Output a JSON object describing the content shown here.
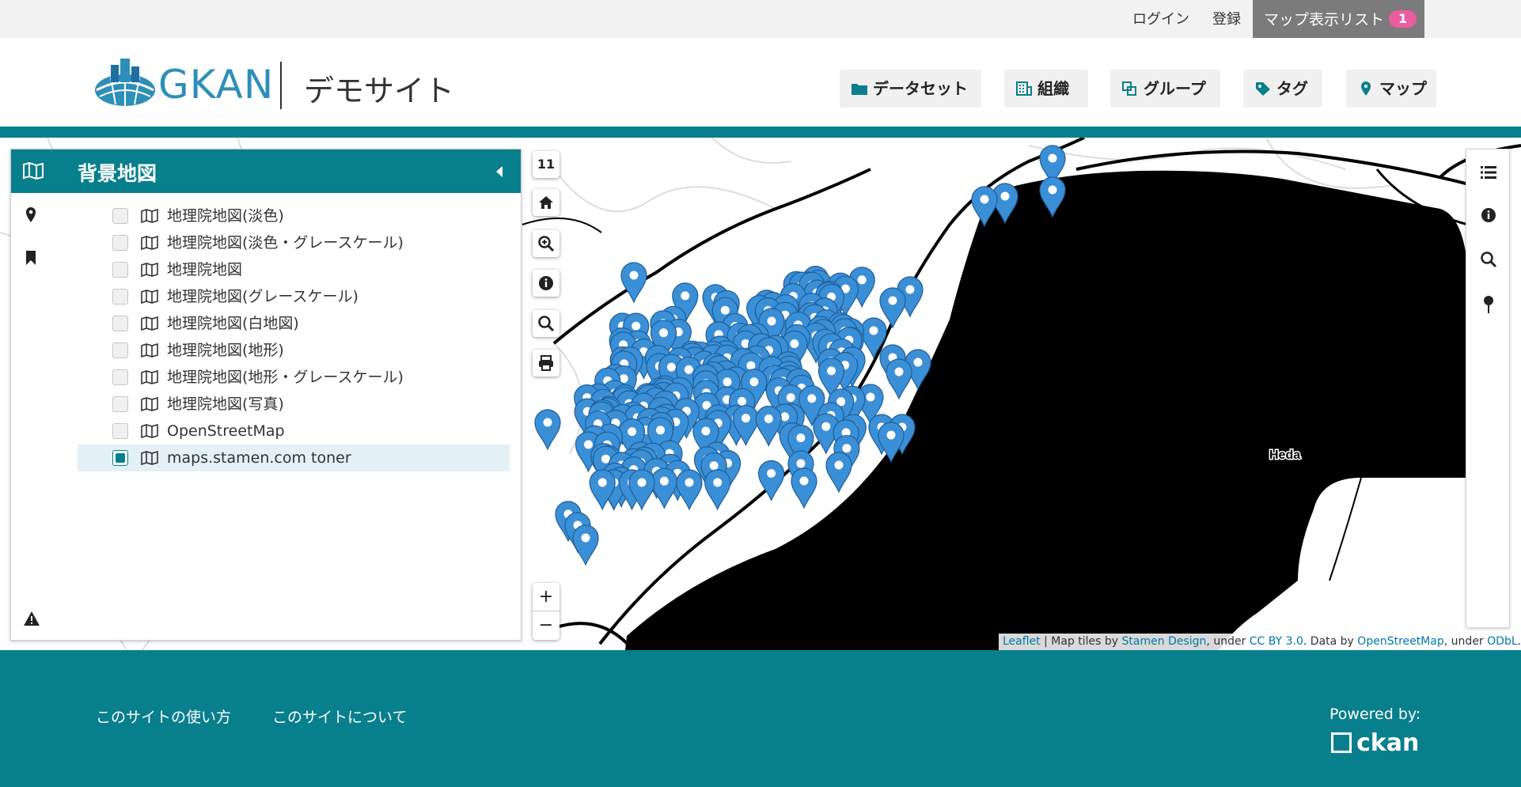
{
  "account_bar": {
    "login": "ログイン",
    "register": "登録",
    "map_list_label": "マップ表示リスト",
    "map_list_count": "1"
  },
  "header": {
    "logo_text": "GKAN",
    "site_title": "デモサイト",
    "nav": [
      {
        "label": "データセット",
        "icon": "folder-icon"
      },
      {
        "label": "組織",
        "icon": "building-icon"
      },
      {
        "label": "グループ",
        "icon": "groups-icon"
      },
      {
        "label": "タグ",
        "icon": "tag-icon"
      },
      {
        "label": "マップ",
        "icon": "map-pin-icon"
      }
    ]
  },
  "sidebar": {
    "title": "背景地図",
    "layers": [
      {
        "label": "地理院地図(淡色)",
        "checked": false
      },
      {
        "label": "地理院地図(淡色・グレースケール)",
        "checked": false
      },
      {
        "label": "地理院地図",
        "checked": false
      },
      {
        "label": "地理院地図(グレースケール)",
        "checked": false
      },
      {
        "label": "地理院地図(白地図)",
        "checked": false
      },
      {
        "label": "地理院地図(地形)",
        "checked": false
      },
      {
        "label": "地理院地図(地形・グレースケール)",
        "checked": false
      },
      {
        "label": "地理院地図(写真)",
        "checked": false
      },
      {
        "label": "OpenStreetMap",
        "checked": false
      },
      {
        "label": "maps.stamen.com toner",
        "checked": true
      }
    ]
  },
  "map": {
    "zoom_level": "11",
    "zoom_in": "+",
    "zoom_out": "−",
    "place_label": "Heda",
    "marker_color": "#3a8fd6"
  },
  "attribution": {
    "leaflet": "Leaflet",
    "tiles_by": " | Map tiles by ",
    "stamen": "Stamen Design",
    "under1": ", under ",
    "ccby": "CC BY 3.0",
    "data_by": ". Data by ",
    "osm": "OpenStreetMap",
    "under2": ", under ",
    "odbl": "ODbL",
    "end": "."
  },
  "footer": {
    "link_howto": "このサイトの使い方",
    "link_about": "このサイトについて",
    "powered_by": "Powered by:",
    "ckan": "ckan"
  },
  "colors": {
    "brand": "#087f8c",
    "marker": "#3a8fd6",
    "badge": "#e95e9f"
  }
}
